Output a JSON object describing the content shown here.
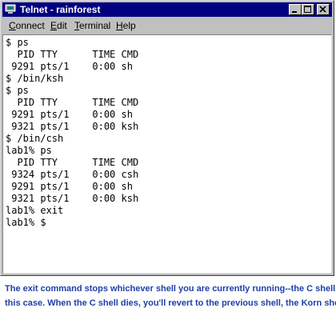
{
  "window": {
    "title": "Telnet - rainforest"
  },
  "menu": {
    "connect": "Connect",
    "edit": "Edit",
    "terminal": "Terminal",
    "help": "Help"
  },
  "terminal": {
    "lines": [
      "$ ps",
      "  PID TTY      TIME CMD",
      " 9291 pts/1    0:00 sh",
      "$ /bin/ksh",
      "$ ps",
      "  PID TTY      TIME CMD",
      " 9291 pts/1    0:00 sh",
      " 9321 pts/1    0:00 ksh",
      "$ /bin/csh",
      "lab1% ps",
      "  PID TTY      TIME CMD",
      " 9324 pts/1    0:00 csh",
      " 9291 pts/1    0:00 sh",
      " 9321 pts/1    0:00 ksh",
      "lab1% exit",
      "lab1% $"
    ]
  },
  "caption": {
    "line1": "The exit command stops whichever shell you are currently running--the C shell in",
    "line2": "this case.  When the C shell dies, you'll revert to the previous shell, the Korn shell."
  },
  "icons": {
    "title_icon": "telnet-computer-icon",
    "minimize": "minimize-icon",
    "maximize": "maximize-icon",
    "close": "close-icon"
  },
  "colors": {
    "titlebar": "#000080",
    "caption_text": "#1f3fa8",
    "window_chrome": "#c0c0c0"
  }
}
